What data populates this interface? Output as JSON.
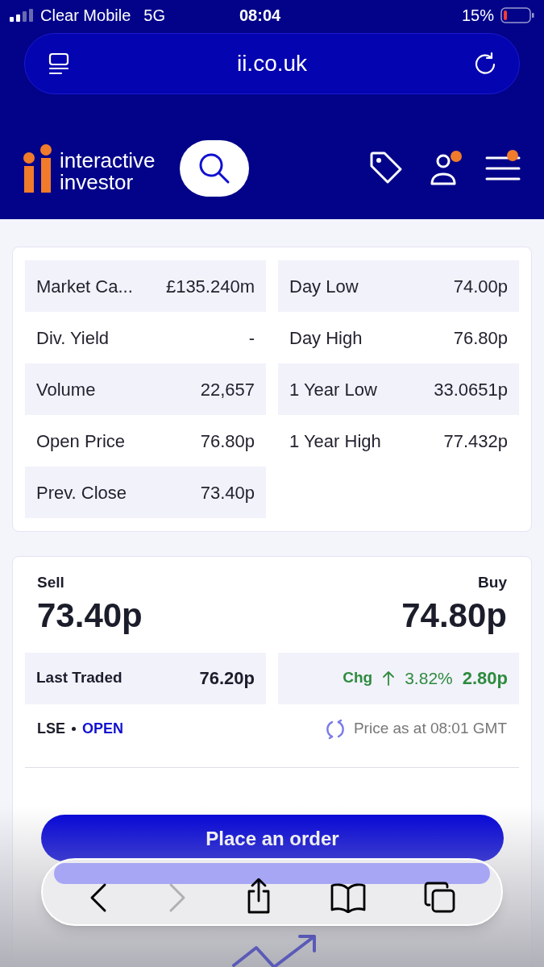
{
  "status_bar": {
    "carrier": "Clear Mobile",
    "network": "5G",
    "time": "08:04",
    "battery": "15%"
  },
  "address_bar": {
    "url": "ii.co.uk"
  },
  "header": {
    "logo_line_1": "interactive",
    "logo_line_2": "investor",
    "account_notification": true,
    "menu_notification": true
  },
  "stats": [
    {
      "left": {
        "label": "Market Ca...",
        "value": "£135.240m"
      },
      "right": {
        "label": "Day Low",
        "value": "74.00p"
      }
    },
    {
      "left": {
        "label": "Div. Yield",
        "value": "-"
      },
      "right": {
        "label": "Day High",
        "value": "76.80p"
      }
    },
    {
      "left": {
        "label": "Volume",
        "value": "22,657"
      },
      "right": {
        "label": "1 Year Low",
        "value": "33.0651p"
      }
    },
    {
      "left": {
        "label": "Open Price",
        "value": "76.80p"
      },
      "right": {
        "label": "1 Year High",
        "value": "77.432p"
      }
    },
    {
      "left": {
        "label": "Prev. Close",
        "value": "73.40p"
      }
    }
  ],
  "quote": {
    "sell_label": "Sell",
    "sell_price": "73.40p",
    "buy_label": "Buy",
    "buy_price": "74.80p",
    "last_traded_label": "Last Traded",
    "last_traded": "76.20p",
    "change_label": "Chg",
    "change_up": true,
    "change_percent": "3.82%",
    "change_value": "2.80p",
    "exchange": "LSE",
    "market_status": "OPEN",
    "market_open": true,
    "price_time": "Price as at 08:01 GMT"
  },
  "order_button": "Place an order",
  "browser_toolbar": {
    "back_disabled": false,
    "forward_disabled": true
  }
}
